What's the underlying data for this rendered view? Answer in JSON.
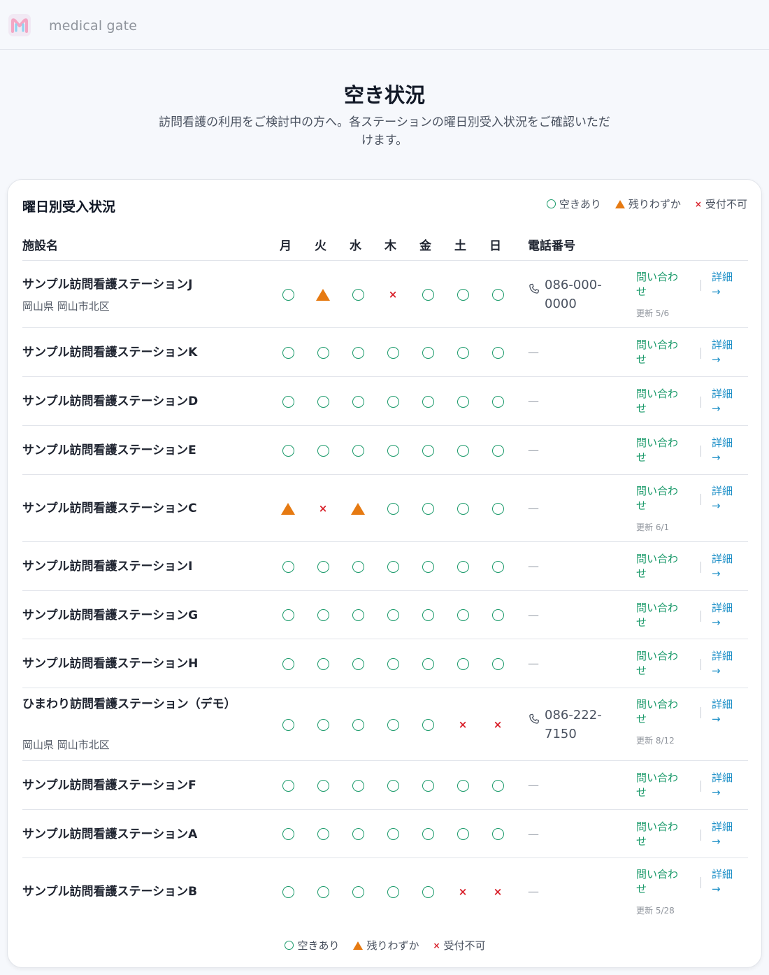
{
  "header": {
    "brand": "medical gate"
  },
  "page": {
    "title": "空き状況",
    "subtitle": "訪問看護の利用をご検討中の方へ。各ステーションの曜日別受入状況をご確認いただけます。"
  },
  "card": {
    "title": "曜日別受入状況"
  },
  "legend": {
    "available": "空きあり",
    "few": "残りわずか",
    "full": "受付不可"
  },
  "colors": {
    "available": "#1a9a6a",
    "few": "#e67a12",
    "full": "#d8202a",
    "link": "#1d8fc7"
  },
  "table": {
    "headers": {
      "name": "施設名",
      "days": [
        "月",
        "火",
        "水",
        "木",
        "金",
        "土",
        "日"
      ],
      "phone": "電話番号"
    },
    "inquiry_label": "問い合わせ",
    "detail_label": "詳細 →",
    "dash": "—",
    "rows": [
      {
        "name": "サンプル訪問看護ステーションJ",
        "address": "岡山県 岡山市北区",
        "days": [
          "o",
          "t",
          "o",
          "x",
          "o",
          "o",
          "o"
        ],
        "phone": "086-000-0000",
        "updated": "更新 5/6"
      },
      {
        "name": "サンプル訪問看護ステーションK",
        "address": "",
        "days": [
          "o",
          "o",
          "o",
          "o",
          "o",
          "o",
          "o"
        ],
        "phone": "",
        "updated": ""
      },
      {
        "name": "サンプル訪問看護ステーションD",
        "address": "",
        "days": [
          "o",
          "o",
          "o",
          "o",
          "o",
          "o",
          "o"
        ],
        "phone": "",
        "updated": ""
      },
      {
        "name": "サンプル訪問看護ステーションE",
        "address": "",
        "days": [
          "o",
          "o",
          "o",
          "o",
          "o",
          "o",
          "o"
        ],
        "phone": "",
        "updated": ""
      },
      {
        "name": "サンプル訪問看護ステーションC",
        "address": "",
        "days": [
          "t",
          "x",
          "t",
          "o",
          "o",
          "o",
          "o"
        ],
        "phone": "",
        "updated": "更新 6/1"
      },
      {
        "name": "サンプル訪問看護ステーションI",
        "address": "",
        "days": [
          "o",
          "o",
          "o",
          "o",
          "o",
          "o",
          "o"
        ],
        "phone": "",
        "updated": ""
      },
      {
        "name": "サンプル訪問看護ステーションG",
        "address": "",
        "days": [
          "o",
          "o",
          "o",
          "o",
          "o",
          "o",
          "o"
        ],
        "phone": "",
        "updated": ""
      },
      {
        "name": "サンプル訪問看護ステーションH",
        "address": "",
        "days": [
          "o",
          "o",
          "o",
          "o",
          "o",
          "o",
          "o"
        ],
        "phone": "",
        "updated": ""
      },
      {
        "name": "ひまわり訪問看護ステーション（デモ）",
        "address": "岡山県 岡山市北区",
        "days": [
          "o",
          "o",
          "o",
          "o",
          "o",
          "x",
          "x"
        ],
        "phone": "086-222-7150",
        "updated": "更新 8/12"
      },
      {
        "name": "サンプル訪問看護ステーションF",
        "address": "",
        "days": [
          "o",
          "o",
          "o",
          "o",
          "o",
          "o",
          "o"
        ],
        "phone": "",
        "updated": ""
      },
      {
        "name": "サンプル訪問看護ステーションA",
        "address": "",
        "days": [
          "o",
          "o",
          "o",
          "o",
          "o",
          "o",
          "o"
        ],
        "phone": "",
        "updated": ""
      },
      {
        "name": "サンプル訪問看護ステーションB",
        "address": "",
        "days": [
          "o",
          "o",
          "o",
          "o",
          "o",
          "x",
          "x"
        ],
        "phone": "",
        "updated": "更新 5/28"
      }
    ]
  }
}
